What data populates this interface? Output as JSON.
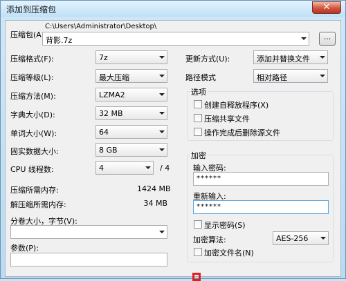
{
  "window": {
    "title": "添加到压缩包",
    "close_glyph": "✕"
  },
  "archive": {
    "label": "压缩包(A):",
    "path": "C:\\Users\\Administrator\\Desktop\\",
    "filename": "背影.7z",
    "browse_label": "..."
  },
  "left": {
    "format": {
      "label": "压缩格式(F):",
      "value": "7z"
    },
    "level": {
      "label": "压缩等级(L):",
      "value": "最大压缩"
    },
    "method": {
      "label": "压缩方法(M):",
      "value": "LZMA2"
    },
    "dict": {
      "label": "字典大小(D):",
      "value": "32 MB"
    },
    "word": {
      "label": "单词大小(W):",
      "value": "64"
    },
    "solid": {
      "label": "固实数据大小:",
      "value": "8 GB"
    },
    "threads": {
      "label": "CPU 线程数:",
      "value": "4",
      "total": "/ 4"
    },
    "mem_compress": {
      "label": "压缩所需内存:",
      "value": "1424 MB"
    },
    "mem_decompress": {
      "label": "解压缩所需内存:",
      "value": "34 MB"
    },
    "split": {
      "label": "分卷大小，字节(V):",
      "value": ""
    },
    "params": {
      "label": "参数(P):",
      "value": ""
    }
  },
  "right": {
    "update": {
      "label": "更新方式(U):",
      "value": "添加并替换文件"
    },
    "path_mode": {
      "label": "路径模式",
      "value": "相对路径"
    },
    "options": {
      "title": "选项",
      "items": [
        "创建自释放程序(X)",
        "压缩共享文件",
        "操作完成后删除源文件"
      ]
    },
    "encryption": {
      "title": "加密",
      "password_label": "输入密码:",
      "password_value": "******",
      "reenter_label": "重新输入:",
      "reenter_value": "******",
      "show_password": "显示密码(S)",
      "method_label": "加密算法:",
      "method_value": "AES-256",
      "encrypt_names": "加密文件名(N)"
    }
  }
}
